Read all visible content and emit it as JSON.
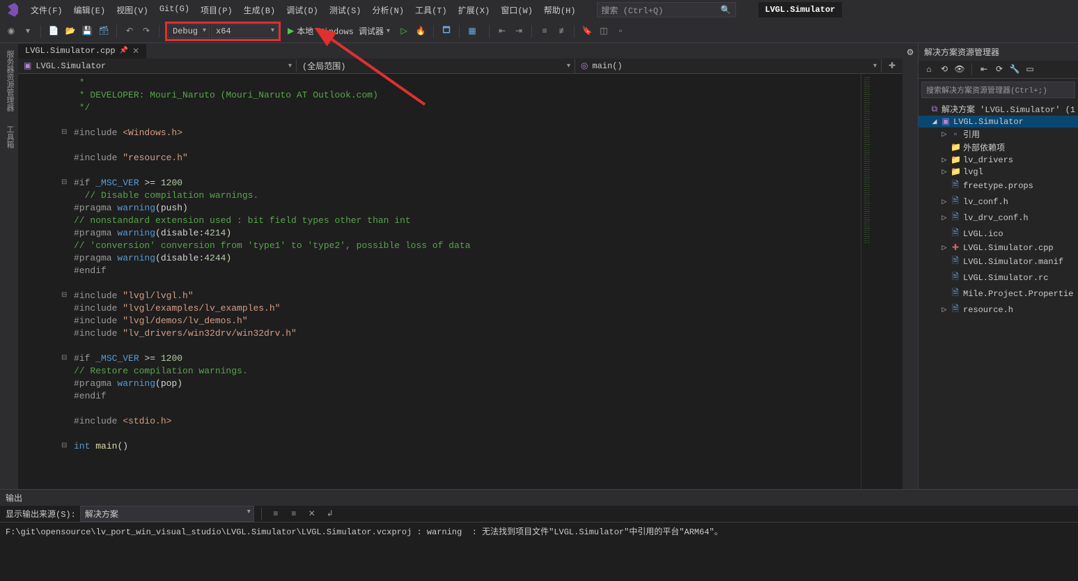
{
  "menubar": {
    "items": [
      "文件(F)",
      "编辑(E)",
      "视图(V)",
      "Git(G)",
      "项目(P)",
      "生成(B)",
      "调试(D)",
      "测试(S)",
      "分析(N)",
      "工具(T)",
      "扩展(X)",
      "窗口(W)",
      "帮助(H)"
    ],
    "search_placeholder": "搜索 (Ctrl+Q)",
    "project_name": "LVGL.Simulator"
  },
  "toolbar": {
    "config": "Debug",
    "platform": "x64",
    "debugger_label": "本地 Windows 调试器"
  },
  "tabs": {
    "active_file": "LVGL.Simulator.cpp"
  },
  "nav": {
    "scope1": "LVGL.Simulator",
    "scope2": "(全局范围)",
    "scope3": "main()"
  },
  "code_lines": [
    {
      "cls": "c-comment",
      "txt": " *"
    },
    {
      "cls": "c-comment",
      "txt": " * DEVELOPER: Mouri_Naruto (Mouri_Naruto AT Outlook.com)"
    },
    {
      "cls": "c-comment",
      "txt": " */"
    },
    {
      "cls": "",
      "txt": ""
    },
    {
      "fold": "⊟",
      "html": "<span class='c-preproc'>#include </span><span class='c-string'>&lt;Windows.h&gt;</span>"
    },
    {
      "cls": "",
      "txt": ""
    },
    {
      "html": "<span class='c-preproc'>#include </span><span class='c-string'>\"resource.h\"</span>"
    },
    {
      "cls": "",
      "txt": ""
    },
    {
      "fold": "⊟",
      "html": "<span class='c-preproc'>#if </span><span class='c-keyword'>_MSC_VER</span> &gt;= <span class='c-number'>1200</span>"
    },
    {
      "cls": "c-comment",
      "txt": "  // Disable compilation warnings."
    },
    {
      "html": "<span class='c-preproc'>#pragma </span><span class='c-keyword'>warning</span>(push)"
    },
    {
      "cls": "c-comment",
      "txt": "// nonstandard extension used : bit field types other than int"
    },
    {
      "html": "<span class='c-preproc'>#pragma </span><span class='c-keyword'>warning</span>(disable:<span class='c-number'>4214</span>)"
    },
    {
      "cls": "c-comment",
      "txt": "// 'conversion' conversion from 'type1' to 'type2', possible loss of data"
    },
    {
      "html": "<span class='c-preproc'>#pragma </span><span class='c-keyword'>warning</span>(disable:<span class='c-number'>4244</span>)"
    },
    {
      "html": "<span class='c-preproc'>#endif</span>"
    },
    {
      "cls": "",
      "txt": ""
    },
    {
      "fold": "⊟",
      "html": "<span class='c-preproc'>#include </span><span class='c-string'>\"lvgl/lvgl.h\"</span>"
    },
    {
      "html": "<span class='c-preproc'>#include </span><span class='c-string'>\"lvgl/examples/lv_examples.h\"</span>"
    },
    {
      "html": "<span class='c-preproc'>#include </span><span class='c-string'>\"lvgl/demos/lv_demos.h\"</span>"
    },
    {
      "html": "<span class='c-preproc'>#include </span><span class='c-string'>\"lv_drivers/win32drv/win32drv.h\"</span>"
    },
    {
      "cls": "",
      "txt": ""
    },
    {
      "fold": "⊟",
      "html": "<span class='c-preproc'>#if </span><span class='c-keyword'>_MSC_VER</span> &gt;= <span class='c-number'>1200</span>"
    },
    {
      "cls": "c-comment",
      "txt": "// Restore compilation warnings."
    },
    {
      "html": "<span class='c-preproc'>#pragma </span><span class='c-keyword'>warning</span>(pop)"
    },
    {
      "html": "<span class='c-preproc'>#endif</span>"
    },
    {
      "cls": "",
      "txt": ""
    },
    {
      "html": "<span class='c-preproc'>#include </span><span class='c-string'>&lt;stdio.h&gt;</span>"
    },
    {
      "cls": "",
      "txt": ""
    },
    {
      "fold": "⊟",
      "html": "<span class='c-type'>int</span> <span class='c-func'>main</span>()"
    }
  ],
  "solution_explorer": {
    "title": "解决方案资源管理器",
    "search_placeholder": "搜索解决方案资源管理器(Ctrl+;)",
    "solution_label": "解决方案 'LVGL.Simulator' (1",
    "project": "LVGL.Simulator",
    "nodes": [
      {
        "depth": 2,
        "tw": "▷",
        "icon": "▫",
        "cls": "file-icon",
        "label": "引用"
      },
      {
        "depth": 2,
        "tw": "",
        "icon": "📁",
        "cls": "folder-icon",
        "label": "外部依赖项"
      },
      {
        "depth": 2,
        "tw": "▷",
        "icon": "📁",
        "cls": "folder-icon",
        "label": "lv_drivers"
      },
      {
        "depth": 2,
        "tw": "▷",
        "icon": "📁",
        "cls": "folder-icon",
        "label": "lvgl"
      },
      {
        "depth": 2,
        "tw": "",
        "icon": "🗎",
        "cls": "file-icon",
        "label": "freetype.props"
      },
      {
        "depth": 2,
        "tw": "▷",
        "icon": "🗎",
        "cls": "file-icon",
        "label": "lv_conf.h"
      },
      {
        "depth": 2,
        "tw": "▷",
        "icon": "🗎",
        "cls": "file-icon",
        "label": "lv_drv_conf.h"
      },
      {
        "depth": 2,
        "tw": "",
        "icon": "🗎",
        "cls": "file-icon",
        "label": "LVGL.ico"
      },
      {
        "depth": 2,
        "tw": "▷",
        "icon": "✚",
        "cls": "cpp-icon",
        "label": "LVGL.Simulator.cpp",
        "red": true
      },
      {
        "depth": 2,
        "tw": "",
        "icon": "🗎",
        "cls": "file-icon",
        "label": "LVGL.Simulator.manif"
      },
      {
        "depth": 2,
        "tw": "",
        "icon": "🗎",
        "cls": "file-icon",
        "label": "LVGL.Simulator.rc"
      },
      {
        "depth": 2,
        "tw": "",
        "icon": "🗎",
        "cls": "file-icon",
        "label": "Mile.Project.Propertie"
      },
      {
        "depth": 2,
        "tw": "▷",
        "icon": "🗎",
        "cls": "file-icon",
        "label": "resource.h"
      }
    ]
  },
  "output": {
    "title": "输出",
    "source_label": "显示输出来源(S):",
    "source_value": "解决方案",
    "text": "F:\\git\\opensource\\lv_port_win_visual_studio\\LVGL.Simulator\\LVGL.Simulator.vcxproj : warning  : 无法找到项目文件\"LVGL.Simulator\"中引用的平台\"ARM64\"。"
  }
}
